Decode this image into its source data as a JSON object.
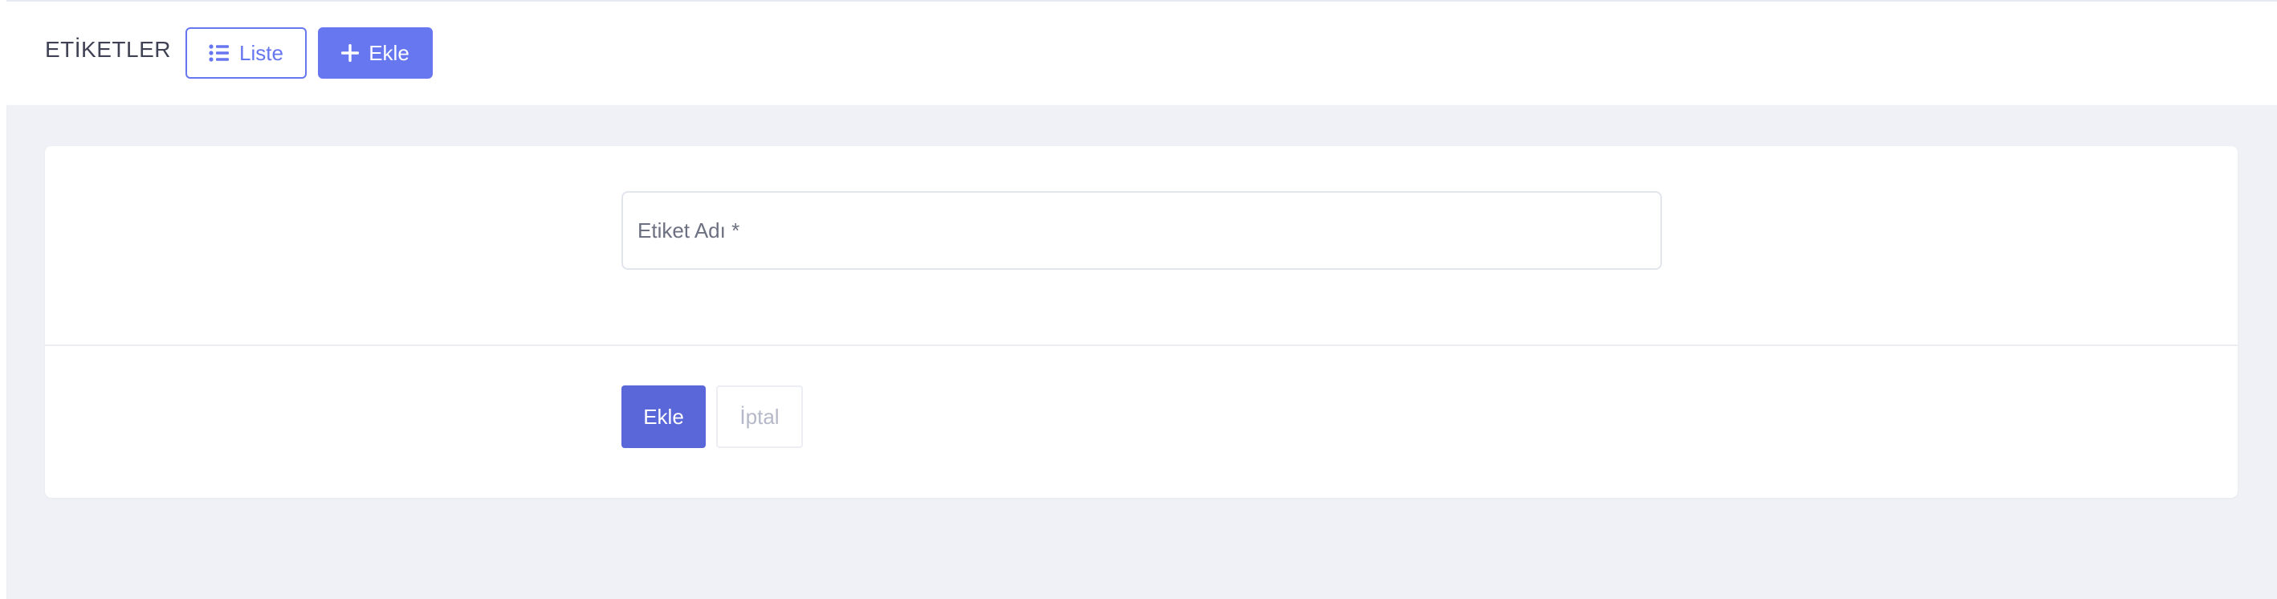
{
  "header": {
    "title": "ETİKETLER",
    "list_button": {
      "label": "Liste",
      "icon": "list-icon"
    },
    "add_button": {
      "label": "Ekle",
      "icon": "plus-icon"
    }
  },
  "form": {
    "name_field": {
      "placeholder": "Etiket Adı *",
      "value": ""
    },
    "submit_label": "Ekle",
    "cancel_label": "İptal"
  },
  "colors": {
    "accent": "#6777f0",
    "submit": "#5a67d8",
    "background": "#f0f1f6"
  }
}
